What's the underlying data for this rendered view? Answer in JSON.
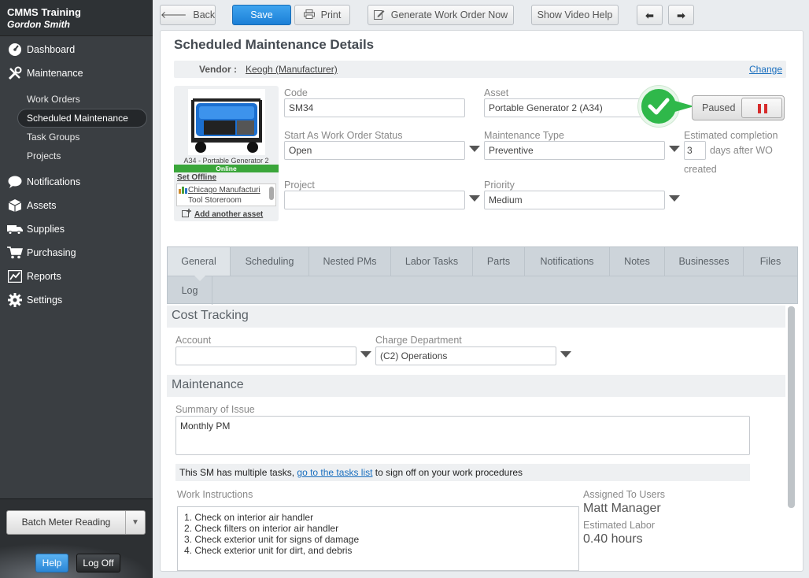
{
  "brand": {
    "title": "CMMS Training",
    "user": "Gordon Smith"
  },
  "nav": {
    "dashboard": "Dashboard",
    "maintenance": "Maintenance",
    "sub": [
      "Work Orders",
      "Scheduled Maintenance",
      "Task Groups",
      "Projects"
    ],
    "notifications": "Notifications",
    "assets": "Assets",
    "supplies": "Supplies",
    "purchasing": "Purchasing",
    "reports": "Reports",
    "settings": "Settings"
  },
  "sidebar_bottom": {
    "batch": "Batch Meter Reading",
    "help": "Help",
    "logoff": "Log Off"
  },
  "toolbar": {
    "back": "Back",
    "save": "Save",
    "print": "Print",
    "generate": "Generate Work Order Now",
    "video": "Show Video Help"
  },
  "page": {
    "title": "Scheduled Maintenance Details",
    "vendor_label": "Vendor :",
    "vendor_value": "Keogh (Manufacturer)",
    "change": "Change"
  },
  "asset_card": {
    "caption": "A34 - Portable Generator 2",
    "status": "Online",
    "set_offline": "Set Offline",
    "location1": "Chicago Manufacturi",
    "location2": "Tool Storeroom",
    "add_asset": "Add another asset"
  },
  "fields": {
    "code_label": "Code",
    "code_value": "SM34",
    "asset_label": "Asset",
    "asset_value": "Portable Generator 2 (A34)",
    "start_status_label": "Start As Work Order Status",
    "start_status_value": "Open",
    "mtype_label": "Maintenance Type",
    "mtype_value": "Preventive",
    "project_label": "Project",
    "project_value": "",
    "priority_label": "Priority",
    "priority_value": "Medium",
    "est_label": "Estimated completion",
    "est_value": "3",
    "est_suffix1": "days after WO",
    "est_suffix2": "created"
  },
  "status_toggle": {
    "label": "Paused"
  },
  "tabs": [
    "General",
    "Scheduling",
    "Nested PMs",
    "Labor Tasks",
    "Parts",
    "Notifications",
    "Notes",
    "Businesses",
    "Files",
    "Log"
  ],
  "cost": {
    "heading": "Cost Tracking",
    "account_label": "Account",
    "account_value": "",
    "charge_label": "Charge Department",
    "charge_value": "(C2) Operations"
  },
  "maintenance": {
    "heading": "Maintenance",
    "summary_label": "Summary of Issue",
    "summary_value": "Monthly PM",
    "info_pre": "This SM has multiple tasks,",
    "info_link": "go to the tasks list",
    "info_post": "to sign off on your work procedures",
    "instructions_label": "Work Instructions",
    "instructions": [
      "1.  Check on interior air handler",
      "2.  Check filters on interior air handler",
      "3.  Check exterior unit for signs of damage",
      "4.  Check exterior unit for dirt, and debris"
    ],
    "assigned_label": "Assigned To Users",
    "assigned_value": "Matt Manager",
    "labor_label": "Estimated Labor",
    "labor_value": "0.40 hours"
  }
}
